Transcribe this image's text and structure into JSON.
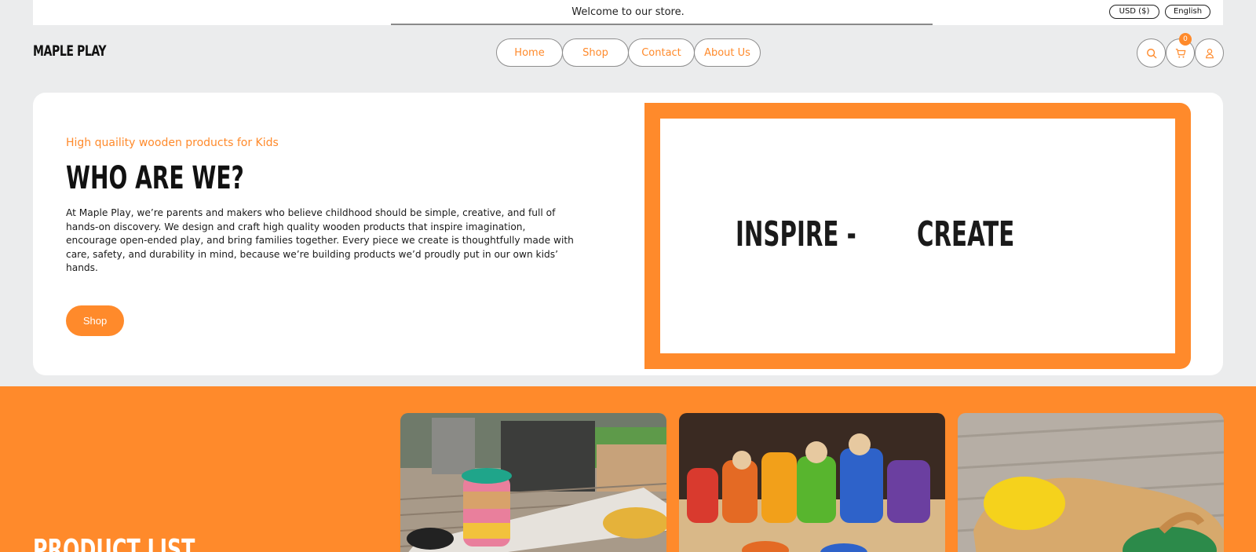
{
  "announcement": {
    "text": "Welcome to our store.",
    "currency": "USD ($)",
    "language": "English"
  },
  "header": {
    "logo": "MAPLE PLAY",
    "nav": [
      "Home",
      "Shop",
      "Contact",
      "About Us"
    ],
    "cart_count": "0"
  },
  "hero": {
    "kicker": "High quaility wooden products for Kids",
    "title": "WHO ARE WE?",
    "body": "At Maple Play, we’re parents and makers who believe childhood should be simple, creative, and full of hands-on discovery. We design and craft high quality wooden products that inspire imagination, encourage open-ended play, and bring families together. Every piece we create is thoughtfully made with care, safety, and durability in mind, because we’re building products we’d proudly put in our own kids’ hands.",
    "cta": "Shop",
    "frame_word_1": "INSPIRE -",
    "frame_word_2": "CREATE"
  },
  "products": {
    "heading": "PRODUCT LIST"
  },
  "colors": {
    "accent": "#ff8a2b",
    "page_bg": "#ebeced",
    "card_bg": "#ffffff"
  }
}
